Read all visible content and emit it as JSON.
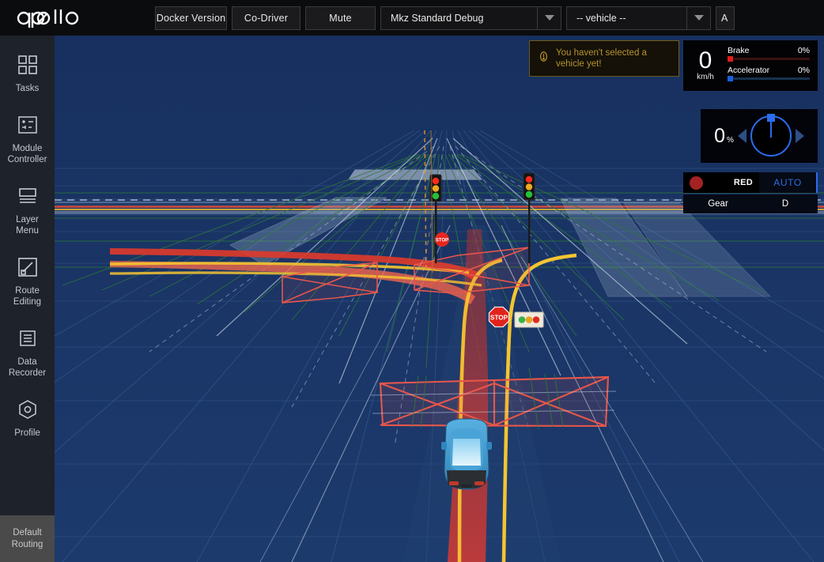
{
  "header": {
    "logo_text": "apollo",
    "buttons": [
      {
        "label": "Docker Version",
        "name": "docker-version-button"
      },
      {
        "label": "Co-Driver",
        "name": "co-driver-button"
      },
      {
        "label": "Mute",
        "name": "mute-button"
      }
    ],
    "selects": [
      {
        "value": "Mkz Standard Debug",
        "name": "vehicle-profile-select"
      },
      {
        "value": "-- vehicle --",
        "name": "vehicle-select"
      }
    ],
    "cut_button": {
      "label": "A",
      "name": "partial-right-button"
    }
  },
  "sidebar": {
    "items": [
      {
        "label": "Tasks",
        "icon": "grid-icon",
        "name": "sidebar-item-tasks"
      },
      {
        "label": "Module\nController",
        "label_line1": "Module",
        "label_line2": "Controller",
        "icon": "module-controller-icon",
        "name": "sidebar-item-module-controller"
      },
      {
        "label_line1": "Layer",
        "label_line2": "Menu",
        "icon": "layers-icon",
        "name": "sidebar-item-layer-menu"
      },
      {
        "label_line1": "Route",
        "label_line2": "Editing",
        "icon": "route-editing-icon",
        "name": "sidebar-item-route-editing"
      },
      {
        "label_line1": "Data",
        "label_line2": "Recorder",
        "icon": "document-icon",
        "name": "sidebar-item-data-recorder"
      },
      {
        "label": "Profile",
        "icon": "hexagon-icon",
        "name": "sidebar-item-profile"
      }
    ],
    "default_routing": {
      "line1": "Default",
      "line2": "Routing"
    }
  },
  "toast": {
    "icon": "warning-icon",
    "message": "You haven't selected a vehicle yet!"
  },
  "hud": {
    "speed": {
      "value": "0",
      "unit": "km/h"
    },
    "brake": {
      "label": "Brake",
      "value": "0%",
      "percent": 0
    },
    "accelerator": {
      "label": "Accelerator",
      "value": "0%",
      "percent": 0
    },
    "steering": {
      "value": "0",
      "unit": "%",
      "angle_deg": 0
    },
    "signal": {
      "light": "RED",
      "mode": "AUTO",
      "light_color": "#a32222"
    },
    "gear": {
      "label": "Gear",
      "value": "D"
    }
  },
  "scene": {
    "background_color": "#1b3564",
    "ego_vehicle": "ego-car",
    "stop_sign_label": "STOP",
    "traffic_light_count": 2,
    "colors": {
      "planned_path": "#e03a2a",
      "lane_boundary": "#f5c431",
      "obstacle_box": "#e8564a",
      "lane_grid": "#4f7fa8",
      "routing_green": "#2f7a37"
    }
  }
}
